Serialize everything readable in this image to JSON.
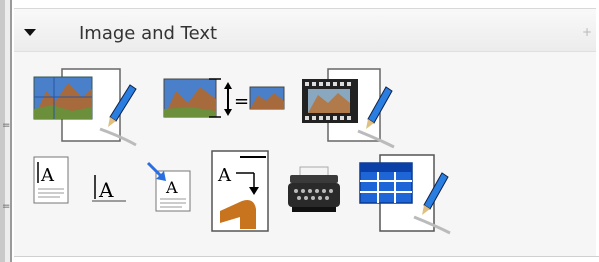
{
  "panel": {
    "title": "Image and Text",
    "pin_glyph": "+",
    "grip_glyph": "=",
    "colors": {
      "background": "#f6f6f6",
      "header": "#ececec",
      "accent_blue": "#1e66d8"
    }
  },
  "tools": [
    {
      "icon": "edit-image-icon"
    },
    {
      "icon": "scale-image-icon",
      "equals_label": "="
    },
    {
      "icon": "edit-filmstrip-icon"
    },
    {
      "icon": "text-block-icon",
      "letter": "A"
    },
    {
      "icon": "plain-text-icon",
      "letter": "A"
    },
    {
      "icon": "import-text-icon",
      "letter": "A"
    },
    {
      "icon": "text-flow-icon",
      "letter": "A"
    },
    {
      "icon": "typewriter-icon"
    },
    {
      "icon": "edit-table-icon"
    }
  ]
}
